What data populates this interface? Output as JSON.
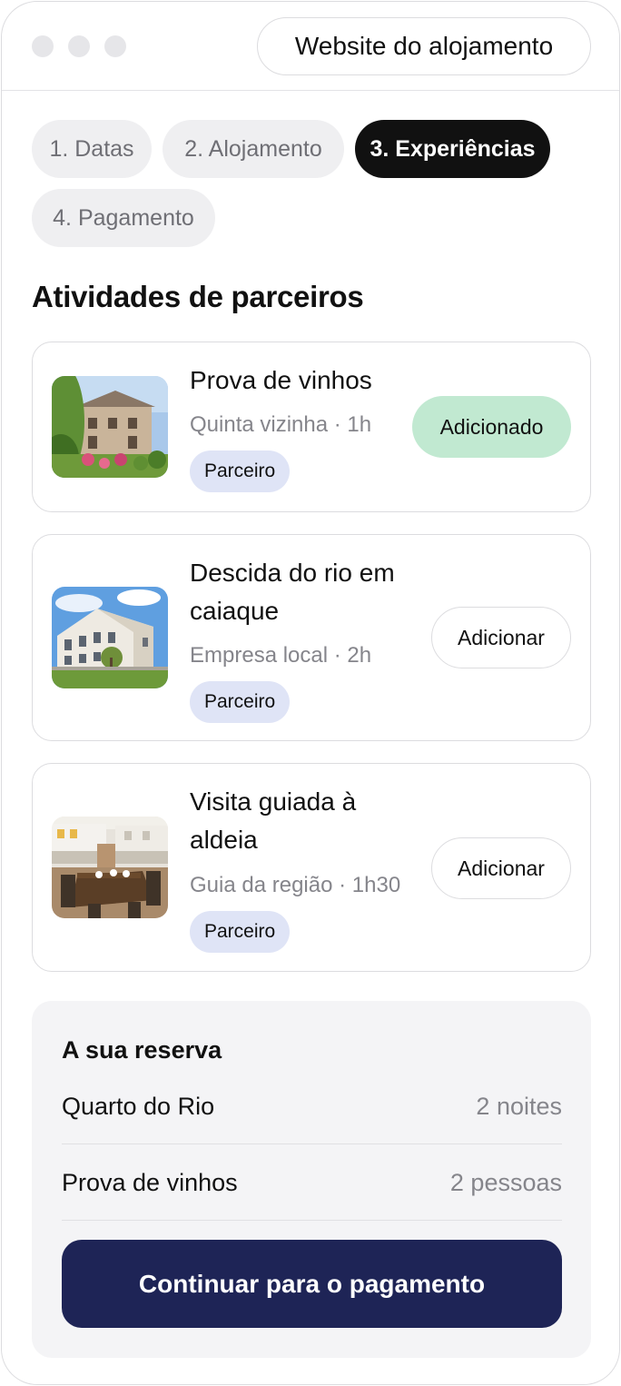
{
  "header": {
    "site_button": "Website do alojamento"
  },
  "steps": [
    {
      "label": "1. Datas",
      "active": false
    },
    {
      "label": "2. Alojamento",
      "active": false
    },
    {
      "label": "3. Experiências",
      "active": true
    },
    {
      "label": "4. Pagamento",
      "active": false
    }
  ],
  "section_title": "Atividades de parceiros",
  "activities": [
    {
      "title": "Prova de vinhos",
      "meta": "Quinta vizinha · 1h",
      "badge": "Parceiro",
      "action": "Adicionado",
      "added": true,
      "image": "stone-house-garden-photo"
    },
    {
      "title": "Descida do rio em caiaque",
      "meta": "Empresa local · 2h",
      "badge": "Parceiro",
      "action": "Adicionar",
      "added": false,
      "image": "white-manor-lawn-photo"
    },
    {
      "title": "Visita guiada à aldeia",
      "meta": "Guia da região · 1h30",
      "badge": "Parceiro",
      "action": "Adicionar",
      "added": false,
      "image": "patio-dining-table-photo"
    }
  ],
  "summary": {
    "title": "A sua reserva",
    "rows": [
      {
        "label": "Quarto do Rio",
        "value": "2 noites"
      },
      {
        "label": "Prova de vinhos",
        "value": "2 pessoas"
      }
    ],
    "cta": "Continuar para o pagamento"
  },
  "colors": {
    "active_step": "#111111",
    "added_button": "#c1e9d1",
    "partner_badge": "#dfe4f6",
    "cta": "#1e2456"
  }
}
